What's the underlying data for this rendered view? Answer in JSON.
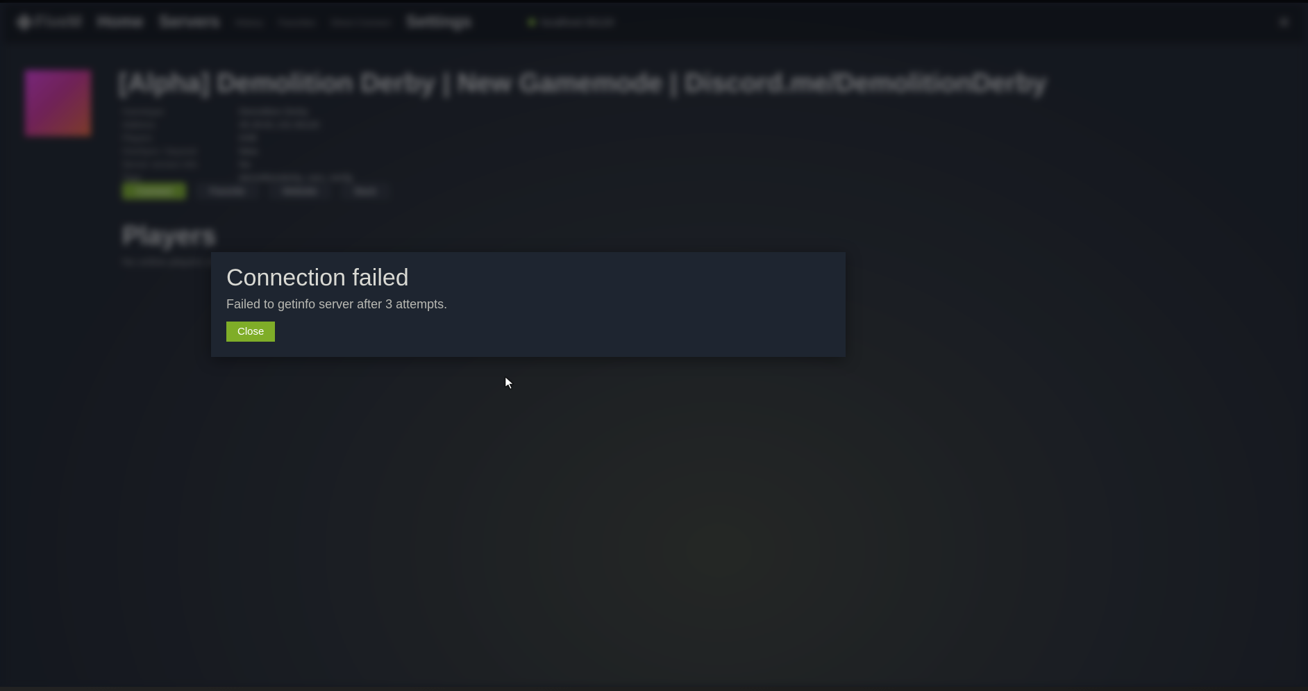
{
  "nav": {
    "logo_text": "FiveM",
    "home": "Home",
    "servers": "Servers",
    "sub_history": "History",
    "sub_favorites": "Favorites",
    "sub_direct": "Direct Connect",
    "settings": "Settings",
    "ip_text": "localhost:30120",
    "close_glyph": "✕"
  },
  "server": {
    "title": "[Alpha] Demolition Derby | New Gamemode | Discord.me/DemolitionDerby",
    "labels": {
      "gametype": "Gametype",
      "address": "Address",
      "players": "Players",
      "onesync": "OneSync / beyond",
      "server_version": "Server version info",
      "tags": "Tags"
    },
    "values": {
      "gametype": "Demolition Derby",
      "address": "45.29.81.131:30120",
      "players": "0/48",
      "onesync": "false",
      "server_version": "No",
      "tags": "demolitionderby, cars, ramfg"
    },
    "buttons": {
      "connect": "Connect",
      "favorite": "Favorite",
      "website": "Website",
      "back": "Back"
    }
  },
  "players": {
    "heading": "Players",
    "subtext": "No online players on this server"
  },
  "modal": {
    "title": "Connection failed",
    "message": "Failed to getinfo server after 3 attempts.",
    "close_label": "Close"
  }
}
